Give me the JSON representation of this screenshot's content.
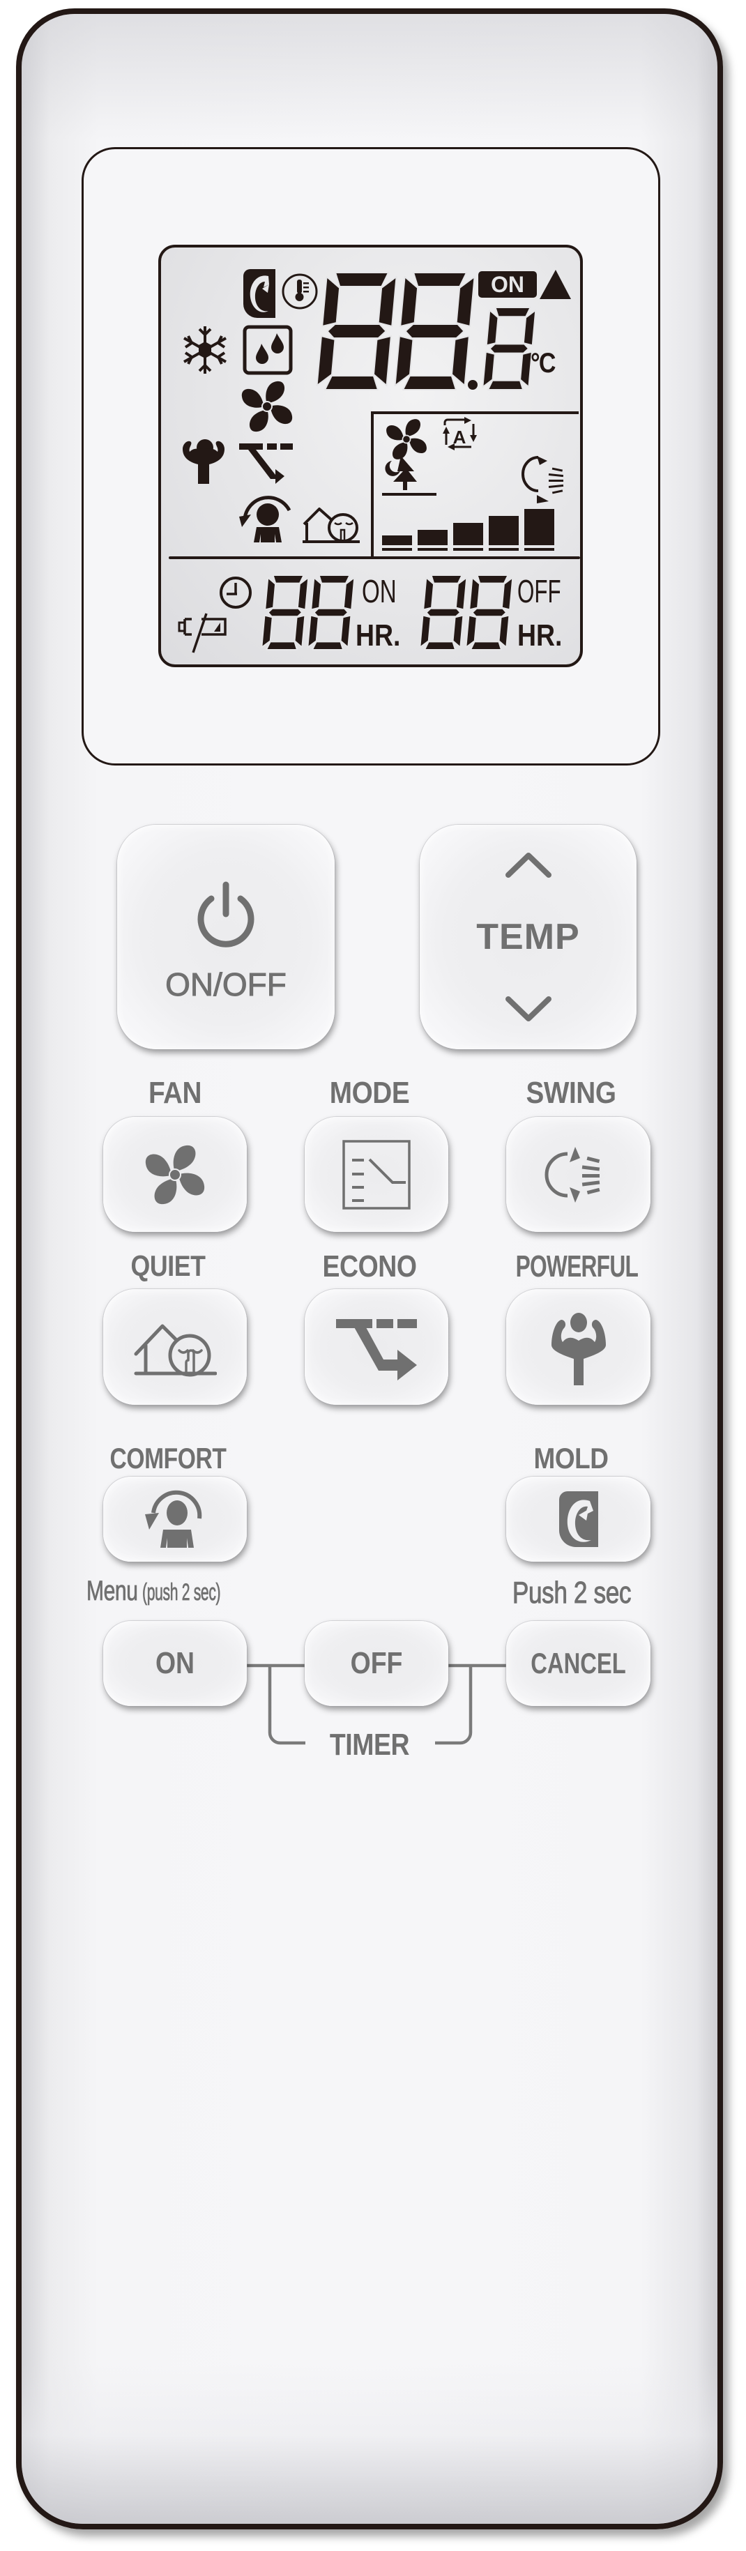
{
  "device": "Air conditioner remote control",
  "lcd": {
    "set_temperature": "88.8",
    "temperature_unit": "°C",
    "on_badge": "ON",
    "timer_on_hours": "88",
    "timer_on_label": "ON",
    "timer_on_unit": "HR.",
    "timer_off_hours": "88",
    "timer_off_label": "OFF",
    "timer_off_unit": "HR.",
    "fan_speed_auto_badge": "A",
    "fan_speed_levels": 5,
    "fan_speed_level": 5,
    "indicators": [
      "mold-icon",
      "sensor-thermometer-icon",
      "cool-mode-snowflake-icon",
      "dry-mode-icon",
      "fan-mode-icon",
      "powerful-icon",
      "econo-icon",
      "comfort-icon",
      "quiet-icon",
      "fan-speed-fan-icon",
      "auto-fan-icon",
      "night-mode-icon",
      "swing-icon",
      "clock-icon",
      "low-battery-icon",
      "up-triangle-icon"
    ]
  },
  "buttons": {
    "power": {
      "label": "ON/OFF",
      "icon": "power-icon"
    },
    "temp": {
      "label": "TEMP",
      "up_icon": "chevron-up-icon",
      "down_icon": "chevron-down-icon"
    },
    "fan": {
      "label": "FAN",
      "icon": "fan-icon"
    },
    "mode": {
      "label": "MODE",
      "icon": "mode-icon"
    },
    "swing": {
      "label": "SWING",
      "icon": "swing-icon"
    },
    "quiet": {
      "label": "QUIET",
      "icon": "quiet-icon"
    },
    "econo": {
      "label": "ECONO",
      "icon": "econo-icon"
    },
    "powerful": {
      "label": "POWERFUL",
      "icon": "powerful-icon"
    },
    "comfort": {
      "label": "COMFORT",
      "icon": "comfort-icon"
    },
    "mold": {
      "label": "MOLD",
      "icon": "mold-icon"
    },
    "timer_on": {
      "label": "ON",
      "caption_main": "Menu",
      "caption_sub": "(push 2 sec)"
    },
    "timer_off": {
      "label": "OFF"
    },
    "timer_cancel": {
      "label": "CANCEL",
      "caption": "Push 2 sec"
    },
    "timer_group_label": "TIMER"
  },
  "colors": {
    "lcd_ink": "#231815",
    "button_ink": "#707070",
    "body_outline": "#231815"
  }
}
